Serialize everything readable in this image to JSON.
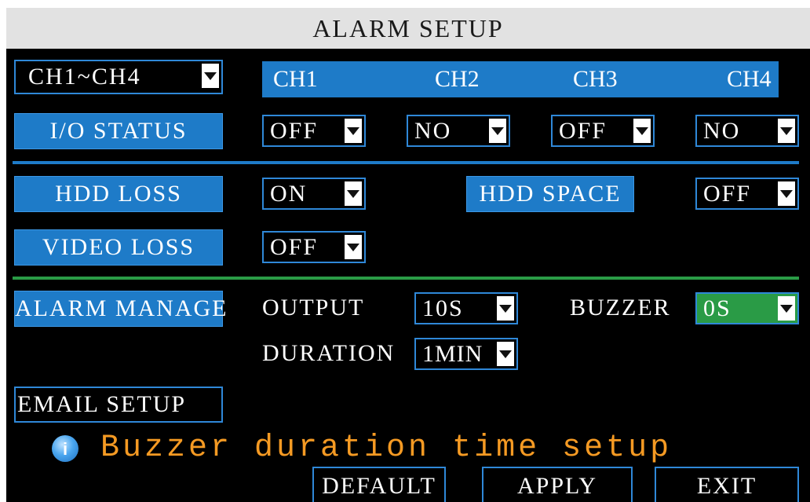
{
  "window": {
    "title": "ALARM SETUP"
  },
  "channel_group": {
    "value": "CH1~CH4"
  },
  "channels": [
    "CH1",
    "CH2",
    "CH3",
    "CH4"
  ],
  "io_status": {
    "label": "I/O STATUS",
    "values": [
      "OFF",
      "NO",
      "OFF",
      "NO"
    ]
  },
  "hdd_loss": {
    "label": "HDD LOSS",
    "value": "ON"
  },
  "hdd_space": {
    "label": "HDD SPACE",
    "value": "OFF"
  },
  "video_loss": {
    "label": "VIDEO LOSS",
    "value": "OFF"
  },
  "alarm_manage": {
    "label": "ALARM MANAGE",
    "output_label": "OUTPUT",
    "output_value": "10S",
    "buzzer_label": "BUZZER",
    "buzzer_value": "0S",
    "duration_label": "DURATION",
    "duration_value": "1MIN"
  },
  "email_setup": {
    "label": "EMAIL SETUP"
  },
  "tip": {
    "icon": "info-icon",
    "text": "Buzzer duration time setup"
  },
  "buttons": {
    "default": "DEFAULT",
    "apply": "APPLY",
    "exit": "EXIT"
  },
  "colors": {
    "accent_blue": "#1e7bc8",
    "separator_blue": "#1e7bc8",
    "separator_green": "#2a9b46",
    "tip_orange": "#f59a23"
  }
}
